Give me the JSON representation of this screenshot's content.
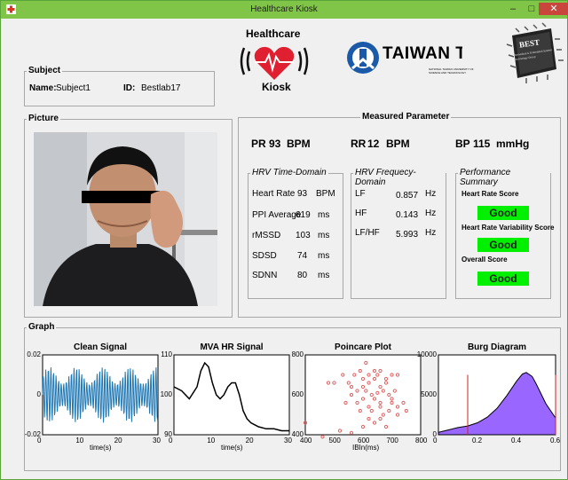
{
  "window": {
    "title": "Healthcare Kiosk",
    "minimize": "–",
    "maximize": "□",
    "close": "✕",
    "app_icon": "medical-cross-icon"
  },
  "logos": {
    "kiosk_top": "Healthcare",
    "kiosk_bottom": "Kiosk",
    "taiwan_tech": "TAIWAN TECH",
    "taiwan_tech_sub": "NATIONAL TAIWAN UNIVERSITY OF SCIENCE AND TECHNOLOGY",
    "best": "BEST",
    "best_sub": "Biomedical & Embedded System Technology Group"
  },
  "subject": {
    "title": "Subject",
    "name_label": "Name:",
    "name_value": "Subject1",
    "id_label": "ID:",
    "id_value": "Bestlab17"
  },
  "picture": {
    "title": "Picture"
  },
  "measured": {
    "title": "Measured Parameter",
    "pr_label": "PR",
    "pr_value": "93",
    "pr_unit": "BPM",
    "rr_label": "RR",
    "rr_value": "12",
    "rr_unit": "BPM",
    "bp_label": "BP",
    "bp_value": "115",
    "bp_unit": "mmHg"
  },
  "hrv_time": {
    "title": "HRV Time-Domain",
    "rows": [
      {
        "label": "Heart Rate",
        "value": "93",
        "unit": "BPM"
      },
      {
        "label": "PPI Average",
        "value": "619",
        "unit": "ms"
      },
      {
        "label": "rMSSD",
        "value": "103",
        "unit": "ms"
      },
      {
        "label": "SDSD",
        "value": "74",
        "unit": "ms"
      },
      {
        "label": "SDNN",
        "value": "80",
        "unit": "ms"
      }
    ]
  },
  "hrv_freq": {
    "title": "HRV Frequecy-Domain",
    "rows": [
      {
        "label": "LF",
        "value": "0.857",
        "unit": "Hz"
      },
      {
        "label": "HF",
        "value": "0.143",
        "unit": "Hz"
      },
      {
        "label": "LF/HF",
        "value": "5.993",
        "unit": "Hz"
      }
    ]
  },
  "performance": {
    "title": "Performance Summary",
    "hr_label": "Heart Rate Score",
    "hr_value": "Good",
    "hrv_label": "Heart Rate Variability Score",
    "hrv_value": "Good",
    "overall_label": "Overall Score",
    "overall_value": "Good"
  },
  "graph": {
    "title": "Graph"
  },
  "chart_data": [
    {
      "type": "line",
      "title": "Clean Signal",
      "xlabel": "time(s)",
      "ylabel": "",
      "xlim": [
        0,
        30
      ],
      "ylim": [
        -0.02,
        0.02
      ],
      "xticks": [
        "0",
        "10",
        "20",
        "30"
      ],
      "yticks": [
        "0.02",
        "0",
        "-0.02"
      ],
      "series": [
        {
          "color": "#1f77b4",
          "note_values": "oscillating signal ~1.5 Hz, amplitude ~0.015"
        }
      ]
    },
    {
      "type": "line",
      "title": "MVA HR Signal",
      "xlabel": "time(s)",
      "ylabel": "",
      "xlim": [
        0,
        30
      ],
      "ylim": [
        90,
        110
      ],
      "xticks": [
        "0",
        "10",
        "20",
        "30"
      ],
      "yticks": [
        "110",
        "100",
        "90"
      ],
      "series": [
        {
          "color": "#000000",
          "x": [
            0,
            2,
            4,
            6,
            7,
            8,
            9,
            10,
            11,
            12,
            13,
            14,
            15,
            16,
            17,
            18,
            19,
            20,
            21,
            22,
            24,
            26,
            28,
            30
          ],
          "y": [
            102,
            101,
            99,
            102,
            106,
            108,
            107,
            103,
            100,
            99,
            100,
            102,
            103,
            103,
            100,
            96,
            94,
            93,
            92.5,
            92,
            91.5,
            91.5,
            91,
            91
          ]
        }
      ]
    },
    {
      "type": "scatter",
      "title": "Poincare Plot",
      "xlabel": "IBIn(ms)",
      "ylabel": "",
      "xlim": [
        400,
        800
      ],
      "ylim": [
        400,
        800
      ],
      "xticks": [
        "400",
        "500",
        "600",
        "700",
        "800"
      ],
      "yticks": [
        "800",
        "600",
        "400"
      ],
      "series": [
        {
          "color": "#e06060",
          "x": [
            480,
            500,
            530,
            550,
            560,
            570,
            590,
            600,
            600,
            620,
            620,
            640,
            640,
            650,
            660,
            660,
            680,
            680,
            700,
            720,
            560,
            580,
            610,
            630,
            650,
            670,
            690,
            710,
            600,
            640,
            660,
            700,
            540,
            580,
            620,
            660,
            700,
            720,
            740,
            590,
            630,
            670,
            690,
            720,
            750,
            400,
            460,
            520,
            560,
            600,
            640,
            680,
            620,
            660,
            610
          ],
          "y": [
            660,
            660,
            700,
            660,
            640,
            700,
            720,
            680,
            640,
            700,
            660,
            720,
            680,
            700,
            640,
            720,
            680,
            660,
            700,
            700,
            600,
            620,
            620,
            600,
            610,
            620,
            600,
            620,
            580,
            580,
            560,
            580,
            560,
            560,
            540,
            540,
            560,
            540,
            560,
            520,
            520,
            500,
            520,
            500,
            520,
            460,
            390,
            420,
            410,
            440,
            460,
            440,
            480,
            480,
            760
          ]
        }
      ]
    },
    {
      "type": "area",
      "title": "Burg Diagram",
      "xlabel": "",
      "ylabel": "",
      "xlim": [
        0,
        0.6
      ],
      "ylim": [
        0,
        10000
      ],
      "xticks": [
        "0",
        "0.2",
        "0.4",
        "0.6"
      ],
      "yticks": [
        "10000",
        "5000",
        "0"
      ],
      "series": [
        {
          "color": "#9966ff",
          "x": [
            0,
            0.05,
            0.1,
            0.15,
            0.2,
            0.25,
            0.3,
            0.35,
            0.4,
            0.43,
            0.45,
            0.48,
            0.5,
            0.55,
            0.6
          ],
          "y": [
            300,
            600,
            900,
            1100,
            1500,
            2200,
            3300,
            4900,
            6700,
            7600,
            7800,
            7300,
            6400,
            3900,
            2100
          ]
        }
      ],
      "markers": [
        0.15,
        0.6
      ]
    }
  ]
}
